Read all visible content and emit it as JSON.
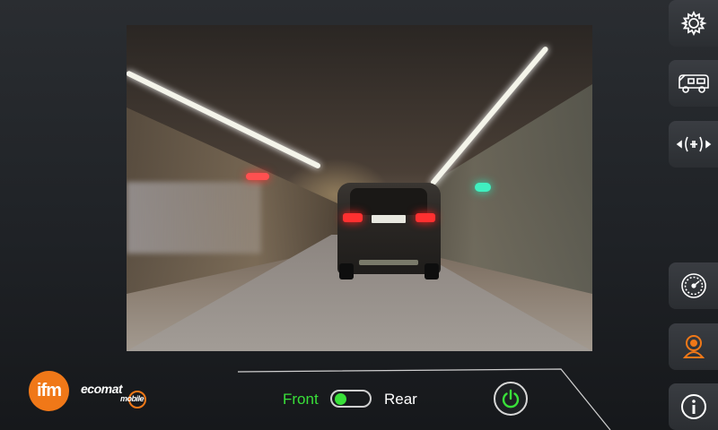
{
  "camera": {
    "feed": "tunnel-road-camera-feed"
  },
  "sidebar": {
    "items": [
      {
        "name": "settings",
        "icon": "gear-icon"
      },
      {
        "name": "vehicle",
        "icon": "camper-van-icon"
      },
      {
        "name": "calibration",
        "icon": "align-arrows-icon"
      },
      {
        "name": "dashboard",
        "icon": "speedometer-icon"
      },
      {
        "name": "camera",
        "icon": "camera-person-icon",
        "active": true
      },
      {
        "name": "info",
        "icon": "info-icon"
      }
    ]
  },
  "footer": {
    "brand": "ifm",
    "product": "ecomat",
    "product_sub": "mobile",
    "camera_toggle": {
      "front_label": "Front",
      "rear_label": "Rear",
      "selected": "Front"
    },
    "power_icon": "power-icon"
  },
  "colors": {
    "accent_orange": "#f07818",
    "active_green": "#39e039",
    "background": "#1f2226"
  }
}
